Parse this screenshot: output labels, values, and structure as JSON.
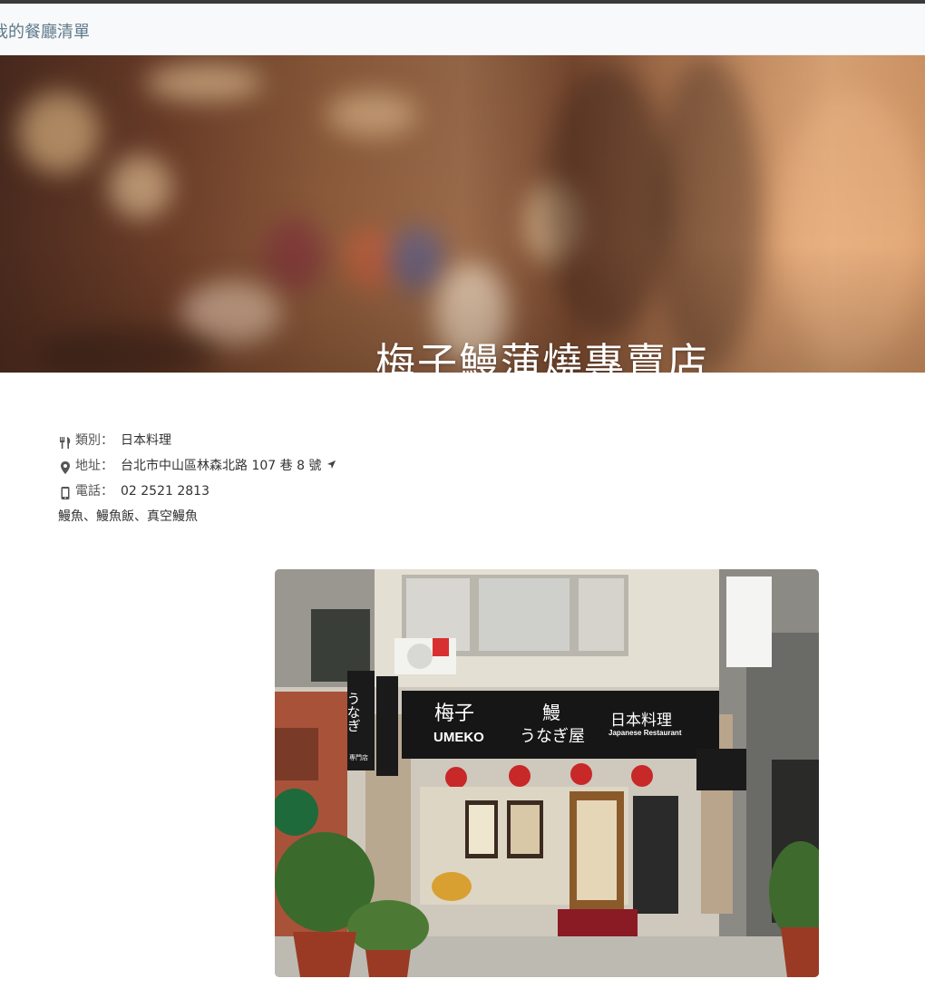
{
  "navbar": {
    "brand": "我的餐廳清單"
  },
  "restaurant": {
    "name": "梅子鰻蒲燒專賣店",
    "category_label": "類別：",
    "category": "日本料理",
    "address_label": "地址：",
    "address": "台北市中山區林森北路 107 巷 8 號",
    "phone_label": "電話：",
    "phone": "02 2521 2813",
    "description": "鰻魚、鰻魚飯、真空鰻魚"
  },
  "storefront_signs": {
    "main_name": "梅子",
    "main_name_en": "UMEKO",
    "eel": "鰻",
    "unagiya": "うなぎ屋",
    "cuisine": "日本料理",
    "cuisine_en": "Japanese Restaurant",
    "side_sign": "うなぎ",
    "side_sign_small": "専門店"
  },
  "icons": {
    "category": "utensils-icon",
    "address": "map-marker-icon",
    "directions": "location-arrow-icon",
    "phone": "mobile-phone-icon"
  },
  "colors": {
    "brand_text": "#5d7a8a",
    "navbar_bg": "#f8f9fa",
    "hero_title": "#ffffff"
  }
}
